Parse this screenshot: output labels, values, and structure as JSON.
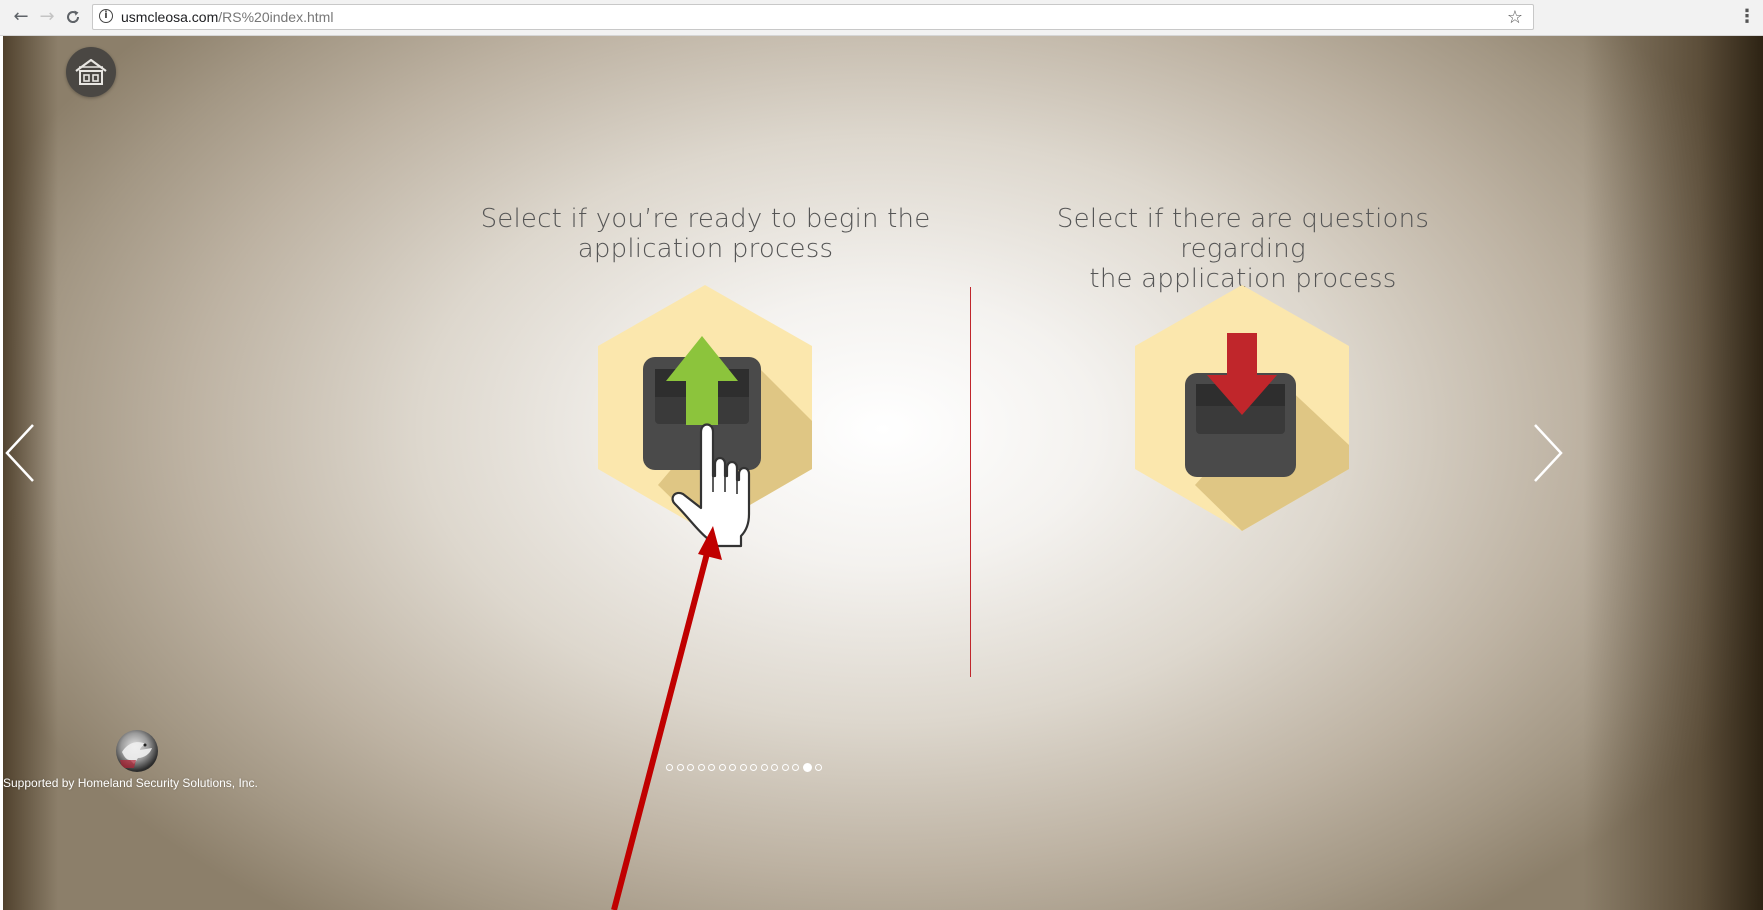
{
  "browser": {
    "back_glyph": "←",
    "forward_glyph": "→",
    "reload_glyph": "C",
    "info_glyph": "i",
    "url_host": "usmcleosa.com",
    "url_path": "/RS%20index.html",
    "bookmark_glyph": "☆",
    "menu_glyph": "⋮"
  },
  "page": {
    "home_icon": "home-icon",
    "options": [
      {
        "title_line1": "Select if you’re ready to begin the",
        "title_line2": "application process",
        "icon": "upload-tray-icon",
        "arrow_color": "#8cc43c"
      },
      {
        "title_line1": "Select if there are questions regarding",
        "title_line2": "the application process",
        "icon": "download-tray-icon",
        "arrow_color": "#c0262b"
      }
    ],
    "divider_color": "#c0262b",
    "hex_color": "#fbe7ad",
    "tray_color": "#4a4a4a",
    "pagination": {
      "total": 15,
      "active_index": 13
    },
    "footer": {
      "credit": "Supported by Homeland Security Solutions, Inc."
    }
  },
  "annotation": {
    "arrow_color": "#c00000"
  }
}
